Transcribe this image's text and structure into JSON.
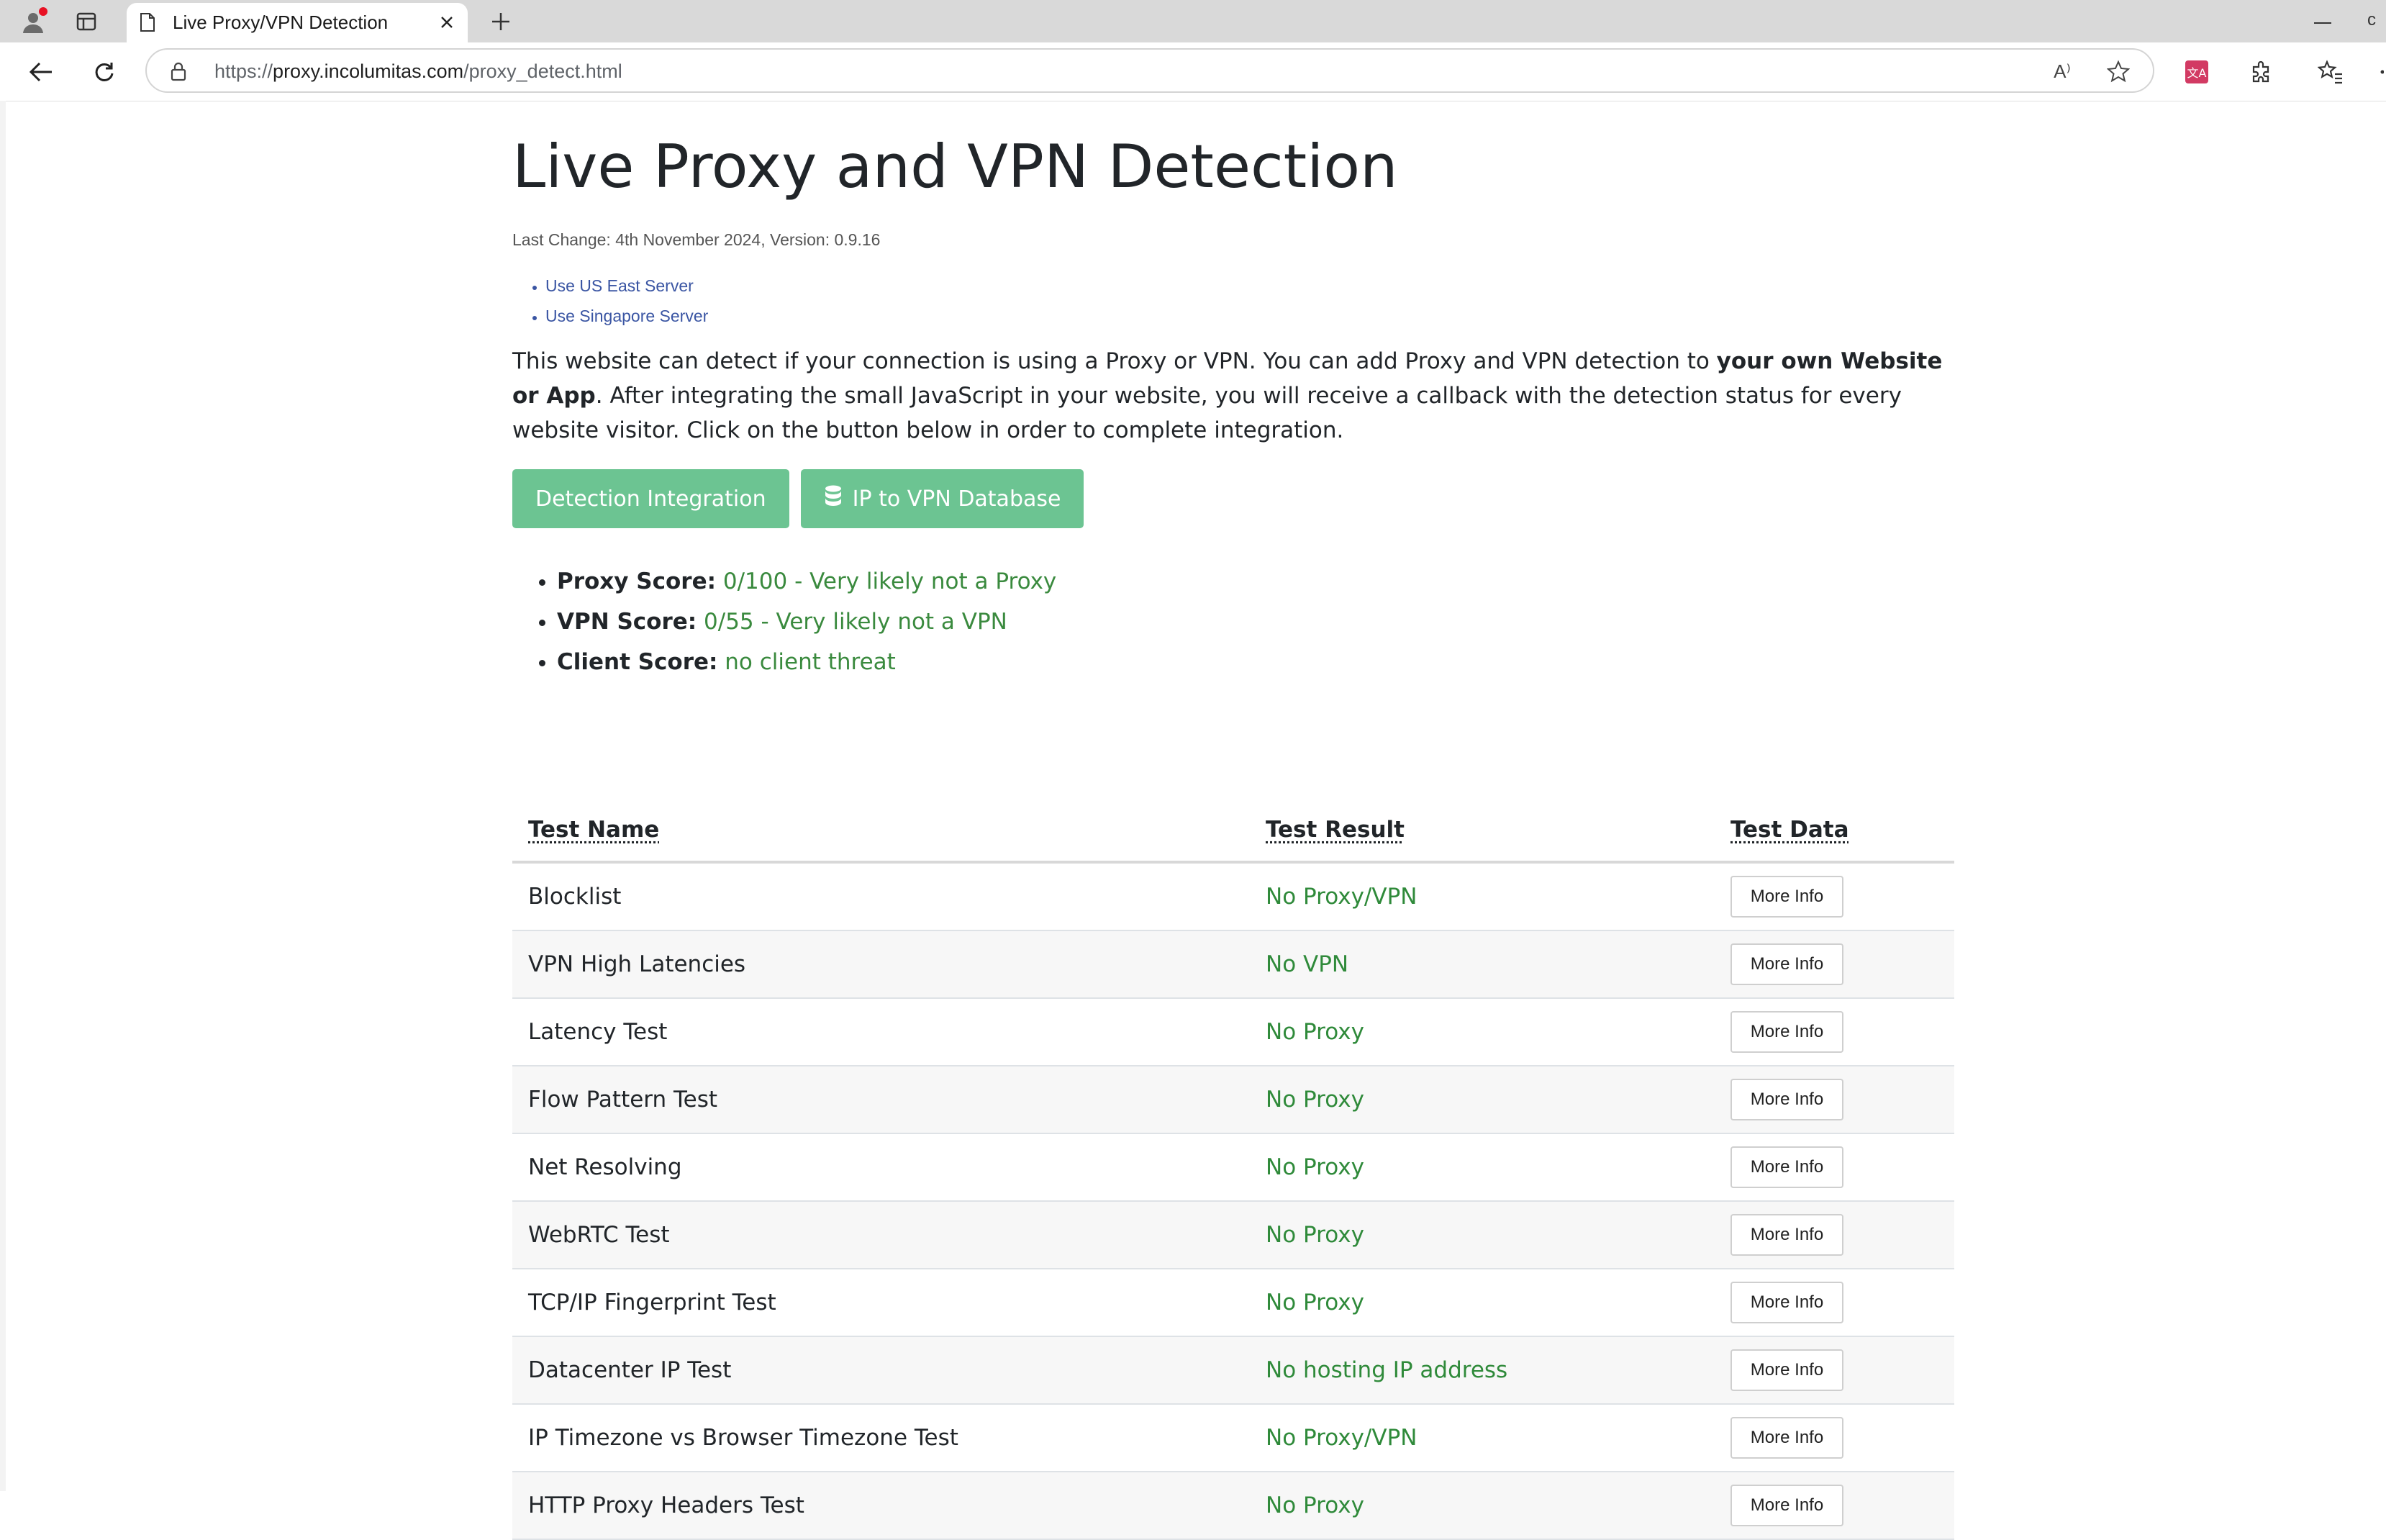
{
  "browser": {
    "tab_title": "Live Proxy/VPN Detection",
    "url_prefix": "https://",
    "url_host": "proxy.incolumitas.com",
    "url_path": "/proxy_detect.html",
    "read_aloud_label": "A⁾",
    "max_hint": "c"
  },
  "page": {
    "title": "Live Proxy and VPN Detection",
    "last_change": "Last Change: 4th November 2024, Version: 0.9.16",
    "servers": [
      "Use US East Server",
      "Use Singapore Server"
    ],
    "intro_part1": "This website can detect if your connection is using a Proxy or VPN. You can add Proxy and VPN detection to ",
    "intro_bold": "your own Website or App",
    "intro_part2": ". After integrating the small JavaScript in your website, you will receive a callback with the detection status for every website visitor. Click on the button below in order to complete integration.",
    "buttons": {
      "integration": "Detection Integration",
      "database": "IP to VPN Database"
    },
    "scores": [
      {
        "label": "Proxy Score:",
        "value": "0/100 - Very likely not a Proxy"
      },
      {
        "label": "VPN Score:",
        "value": "0/55 - Very likely not a VPN"
      },
      {
        "label": "Client Score:",
        "value": "no client threat"
      }
    ],
    "table": {
      "headers": [
        "Test Name",
        "Test Result",
        "Test Data"
      ],
      "more_label": "More Info",
      "rows": [
        {
          "name": "Blocklist",
          "result": "No Proxy/VPN"
        },
        {
          "name": "VPN High Latencies",
          "result": "No VPN"
        },
        {
          "name": "Latency Test",
          "result": "No Proxy"
        },
        {
          "name": "Flow Pattern Test",
          "result": "No Proxy"
        },
        {
          "name": "Net Resolving",
          "result": "No Proxy"
        },
        {
          "name": "WebRTC Test",
          "result": "No Proxy"
        },
        {
          "name": "TCP/IP Fingerprint Test",
          "result": "No Proxy"
        },
        {
          "name": "Datacenter IP Test",
          "result": "No hosting IP address"
        },
        {
          "name": "IP Timezone vs Browser Timezone Test",
          "result": "No Proxy/VPN"
        },
        {
          "name": "HTTP Proxy Headers Test",
          "result": "No Proxy"
        }
      ]
    }
  },
  "colors": {
    "button_green": "#6cc492",
    "result_green": "#2f8a3a",
    "link_blue": "#3a55a3"
  }
}
